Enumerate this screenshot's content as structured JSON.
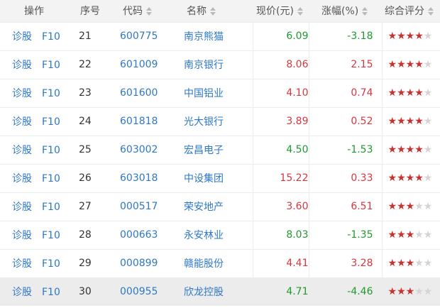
{
  "header": {
    "op": "操作",
    "seq": "序号",
    "code": "代码",
    "name": "名称",
    "price": "现价(元)",
    "change": "涨幅(%)",
    "rating": "综合评分"
  },
  "colors": {
    "link": "#2e78c7",
    "up": "#d9363e",
    "down": "#1f9a2e",
    "star_on": "#c8312d",
    "star_off": "#d4d4d4"
  },
  "rows": [
    {
      "op1": "诊股",
      "op2": "F10",
      "seq": "21",
      "code": "600775",
      "name": "南京熊猫",
      "price": "6.09",
      "change": "-3.18",
      "dir": "down",
      "stars": 4
    },
    {
      "op1": "诊股",
      "op2": "F10",
      "seq": "22",
      "code": "601009",
      "name": "南京银行",
      "price": "8.06",
      "change": "2.15",
      "dir": "up",
      "stars": 4
    },
    {
      "op1": "诊股",
      "op2": "F10",
      "seq": "23",
      "code": "601600",
      "name": "中国铝业",
      "price": "4.10",
      "change": "0.74",
      "dir": "up",
      "stars": 4
    },
    {
      "op1": "诊股",
      "op2": "F10",
      "seq": "24",
      "code": "601818",
      "name": "光大银行",
      "price": "3.89",
      "change": "0.52",
      "dir": "up",
      "stars": 4
    },
    {
      "op1": "诊股",
      "op2": "F10",
      "seq": "25",
      "code": "603002",
      "name": "宏昌电子",
      "price": "4.50",
      "change": "-1.53",
      "dir": "down",
      "stars": 4
    },
    {
      "op1": "诊股",
      "op2": "F10",
      "seq": "26",
      "code": "603018",
      "name": "中设集团",
      "price": "15.22",
      "change": "0.33",
      "dir": "up",
      "stars": 4
    },
    {
      "op1": "诊股",
      "op2": "F10",
      "seq": "27",
      "code": "000517",
      "name": "荣安地产",
      "price": "3.60",
      "change": "6.51",
      "dir": "up",
      "stars": 3
    },
    {
      "op1": "诊股",
      "op2": "F10",
      "seq": "28",
      "code": "000663",
      "name": "永安林业",
      "price": "8.03",
      "change": "-1.35",
      "dir": "down",
      "stars": 3
    },
    {
      "op1": "诊股",
      "op2": "F10",
      "seq": "29",
      "code": "000899",
      "name": "赣能股份",
      "price": "4.41",
      "change": "3.28",
      "dir": "up",
      "stars": 3
    },
    {
      "op1": "诊股",
      "op2": "F10",
      "seq": "30",
      "code": "000955",
      "name": "欣龙控股",
      "price": "4.71",
      "change": "-4.46",
      "dir": "down",
      "stars": 3
    }
  ],
  "max_stars": 5
}
